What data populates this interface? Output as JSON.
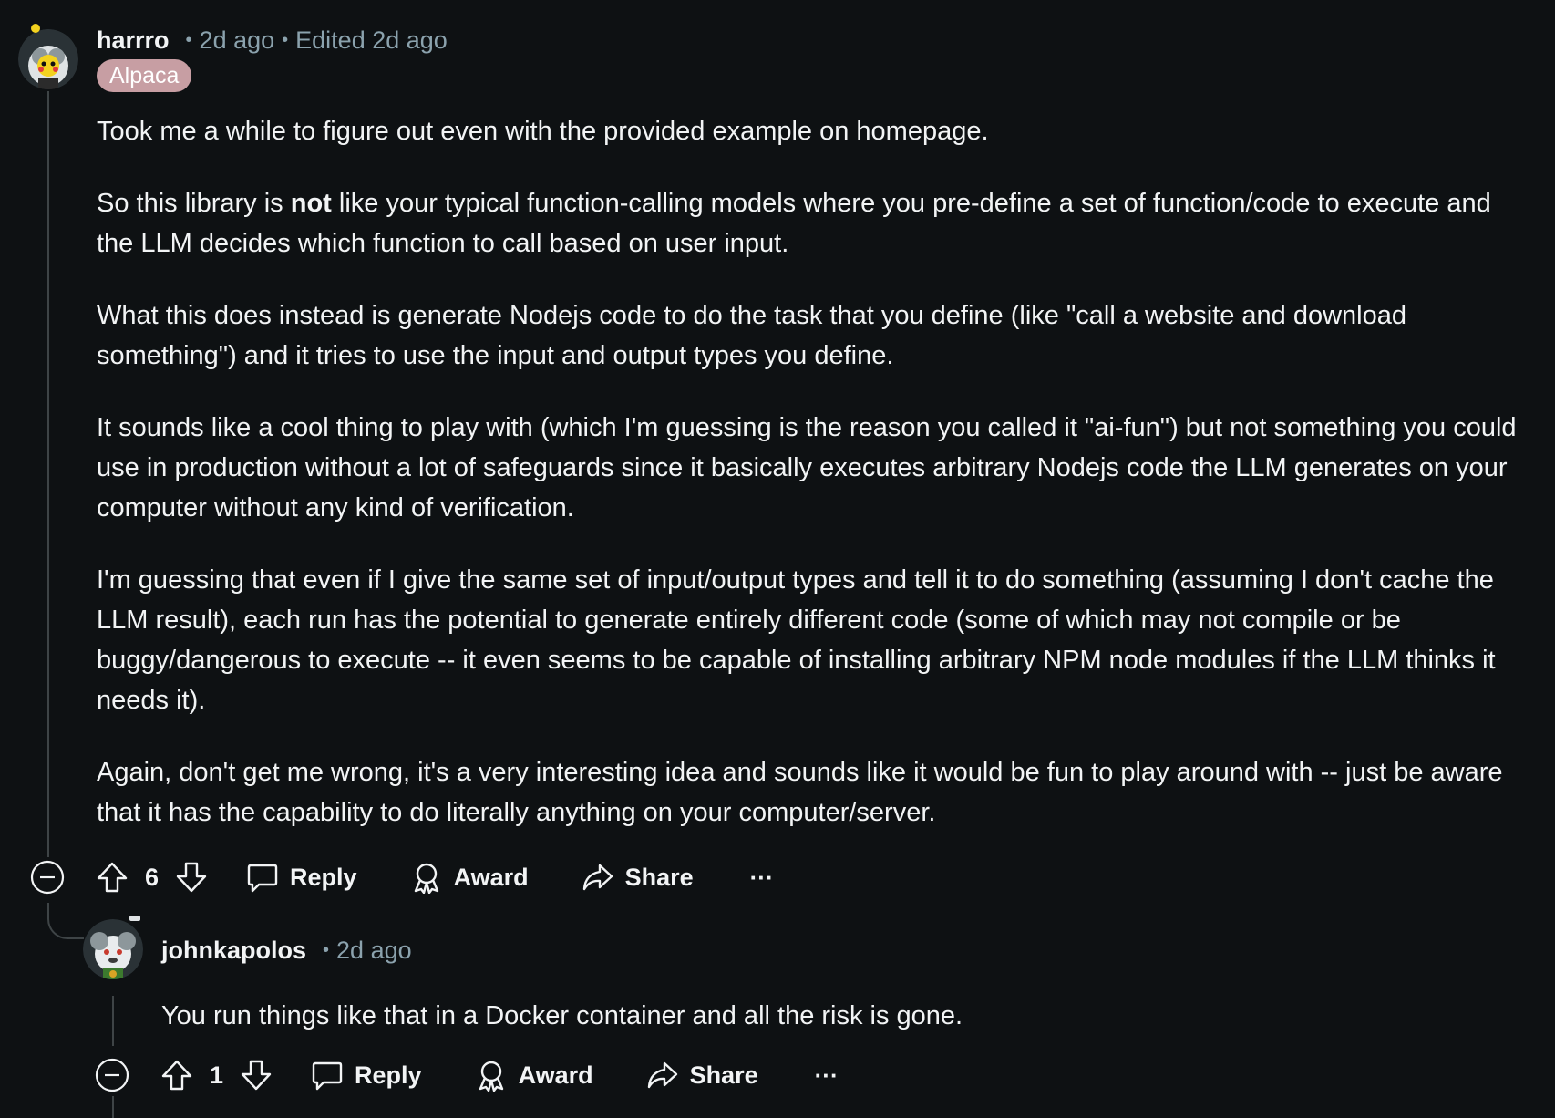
{
  "comments": [
    {
      "author": "harrro",
      "time": "2d ago",
      "edited": "Edited 2d ago",
      "flair": "Alpaca",
      "paragraphs": {
        "p1": "Took me a while to figure out even with the provided example on homepage.",
        "p2_before": "So this library is ",
        "p2_bold": "not",
        "p2_after": " like your typical function-calling models where you pre-define a set of function/code to execute and the LLM decides which function to call based on user input.",
        "p3": "What this does instead is generate Nodejs code to do the task that you define (like \"call a website and download something\") and it tries to use the input and output types you define.",
        "p4": "It sounds like a cool thing to play with (which I'm guessing is the reason you called it \"ai-fun\") but not something you could use in production without a lot of safeguards since it basically executes arbitrary Nodejs code the LLM generates on your computer without any kind of verification.",
        "p5": "I'm guessing that even if I give the same set of input/output types and tell it to do something (assuming I don't cache the LLM result), each run has the potential to generate entirely different code (some of which may not compile or be buggy/dangerous to execute -- it even seems to be capable of installing arbitrary NPM node modules if the LLM thinks it needs it).",
        "p6": "Again, don't get me wrong, it's a very interesting idea and sounds like it would be fun to play around with -- just be aware that it has the capability to do literally anything on your computer/server."
      },
      "votes": "6",
      "actions": {
        "reply": "Reply",
        "award": "Award",
        "share": "Share",
        "more": "···"
      }
    },
    {
      "author": "johnkapolos",
      "time": "2d ago",
      "body": "You run things like that in a Docker container and all the risk is gone.",
      "votes": "1",
      "actions": {
        "reply": "Reply",
        "award": "Award",
        "share": "Share",
        "more": "···"
      }
    }
  ],
  "colors": {
    "background": "#0e1113",
    "text": "#f2f4f5",
    "meta": "#8ba2ad",
    "flair": "#c79ea3",
    "thread_line": "#3e4446"
  },
  "icons": [
    "collapse-icon",
    "upvote-icon",
    "downvote-icon",
    "reply-icon",
    "award-icon",
    "share-icon",
    "more-icon"
  ]
}
